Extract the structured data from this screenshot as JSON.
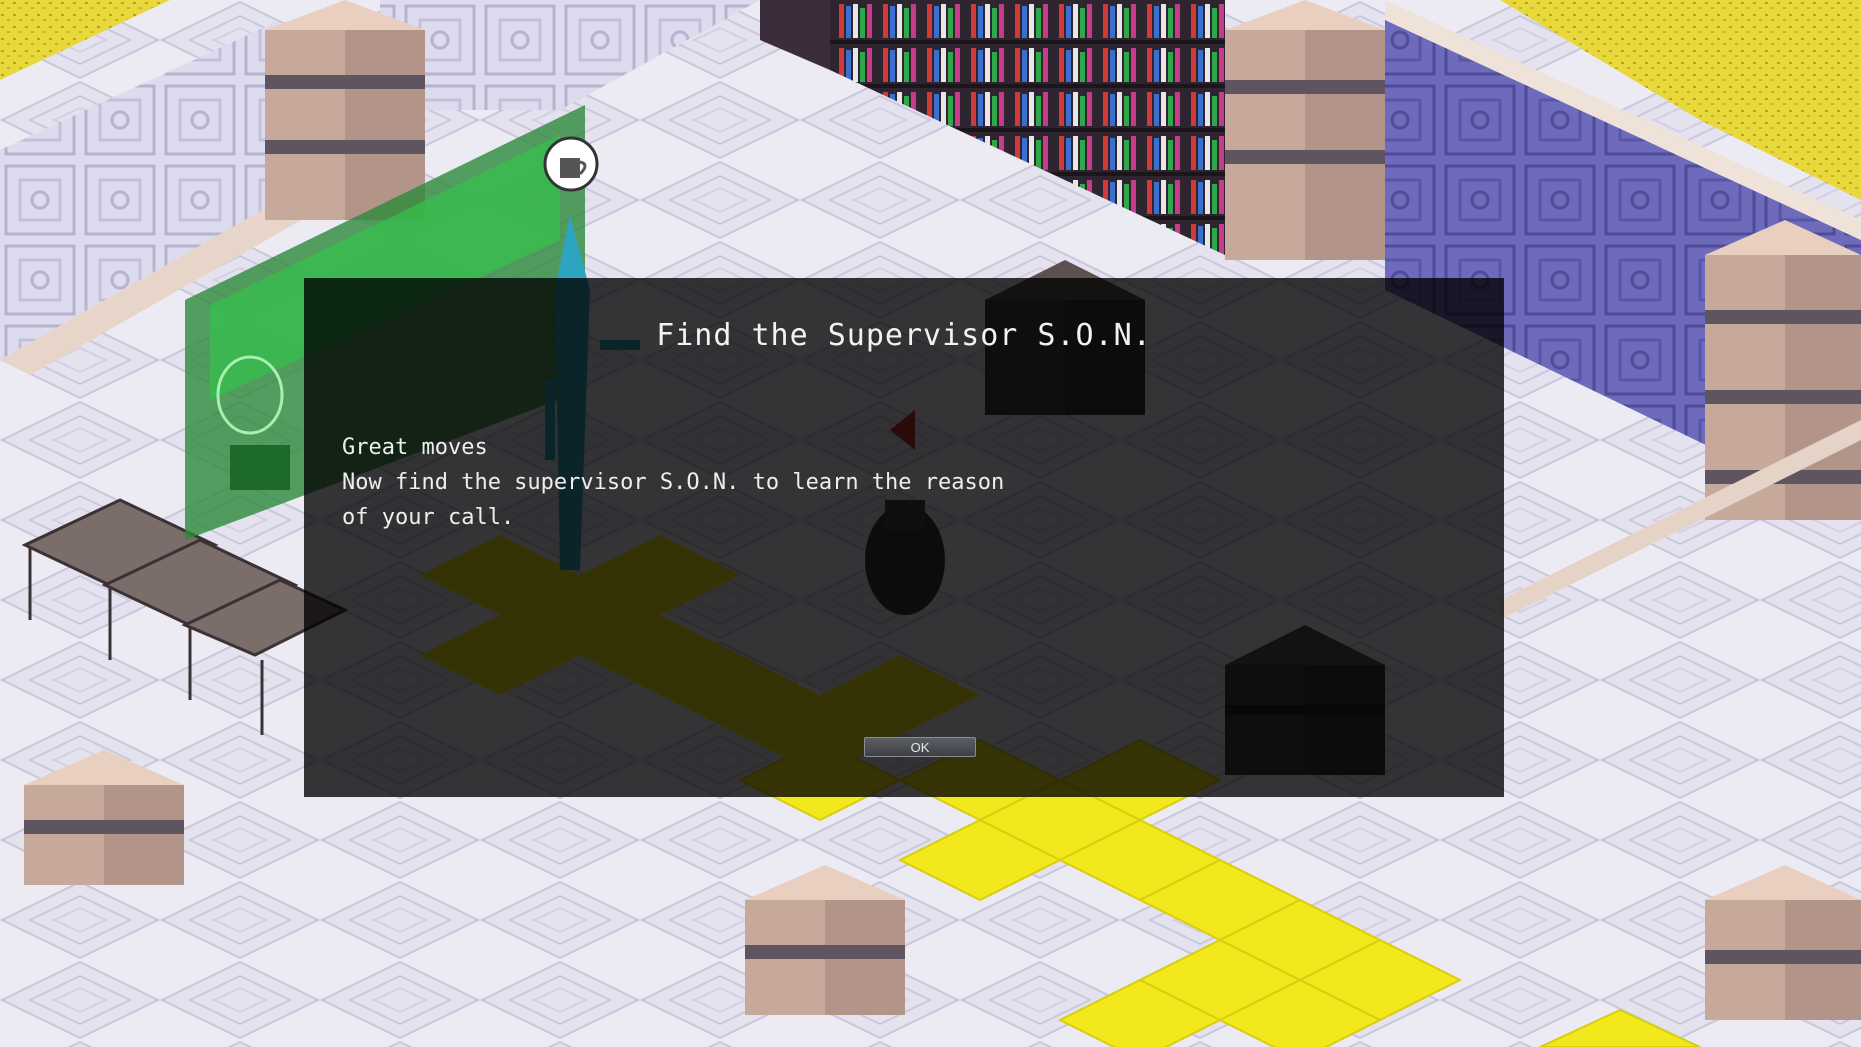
{
  "game": {
    "floor_icon": "checkered-marble-floor",
    "colors": {
      "floor_light": "#ecebf3",
      "floor_pattern": "#c9c6dc",
      "yellow_path": "#f2e81c",
      "pillar_top": "#e8cfc0",
      "pillar_band": "#7b6e78",
      "wall_lavender": "#d8d6ea",
      "wall_purple": "#6b68b8",
      "hologram_green": "#2db34a",
      "bookshelf": "#3a2b3a",
      "grass_yellow": "#e6d63a"
    },
    "objects": {
      "npc": "scarecrow-npc-icon",
      "player": "player-character-icon",
      "coffee": "coffee-cup-icon",
      "bookshelf": "bookshelf-icon",
      "hologram": "hologram-screen-icon"
    }
  },
  "dialog": {
    "title": "Find the Supervisor S.O.N.",
    "lines": [
      "Great moves",
      "Now find the supervisor S.O.N. to learn the reason",
      "of your call."
    ],
    "ok_label": "OK"
  }
}
